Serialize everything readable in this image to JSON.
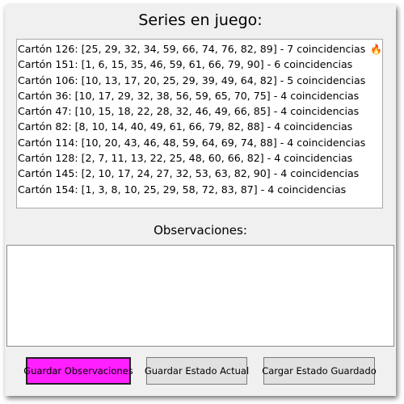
{
  "series_section": {
    "title": "Series en juego:",
    "rows": [
      "Cartón 126: [25, 29, 32, 34, 59, 66, 74, 76, 82, 89] - 7 coincidencias",
      "Cartón 151: [1, 6, 15, 35, 46, 59, 61, 66, 79, 90] - 6 coincidencias",
      "Cartón 106: [10, 13, 17, 20, 25, 29, 39, 49, 64, 82] - 5 coincidencias",
      "Cartón 36: [10, 17, 29, 32, 38, 56, 59, 65, 70, 75] - 4 coincidencias",
      "Cartón 47: [10, 15, 18, 22, 28, 32, 46, 49, 66, 85] - 4 coincidencias",
      "Cartón 82: [8, 10, 14, 40, 49, 61, 66, 79, 82, 88] - 4 coincidencias",
      "Cartón 114: [10, 20, 43, 46, 48, 59, 64, 69, 74, 88] - 4 coincidencias",
      "Cartón 128: [2, 7, 11, 13, 22, 25, 48, 60, 66, 82] - 4 coincidencias",
      "Cartón 145: [2, 10, 17, 24, 27, 32, 53, 63, 82, 90] - 4 coincidencias",
      "Cartón 154: [1, 3, 8, 10, 25, 29, 58, 72, 83, 87] - 4 coincidencias"
    ],
    "top_row_icon": "fire-icon",
    "top_row_icon_glyph": "🔥"
  },
  "observations": {
    "title": "Observaciones:",
    "value": ""
  },
  "buttons": {
    "save_observations": "Guardar Observaciones",
    "save_state": "Guardar Estado Actual",
    "load_state": "Cargar Estado Guardado"
  },
  "colors": {
    "active_button": "#ff1fff"
  }
}
